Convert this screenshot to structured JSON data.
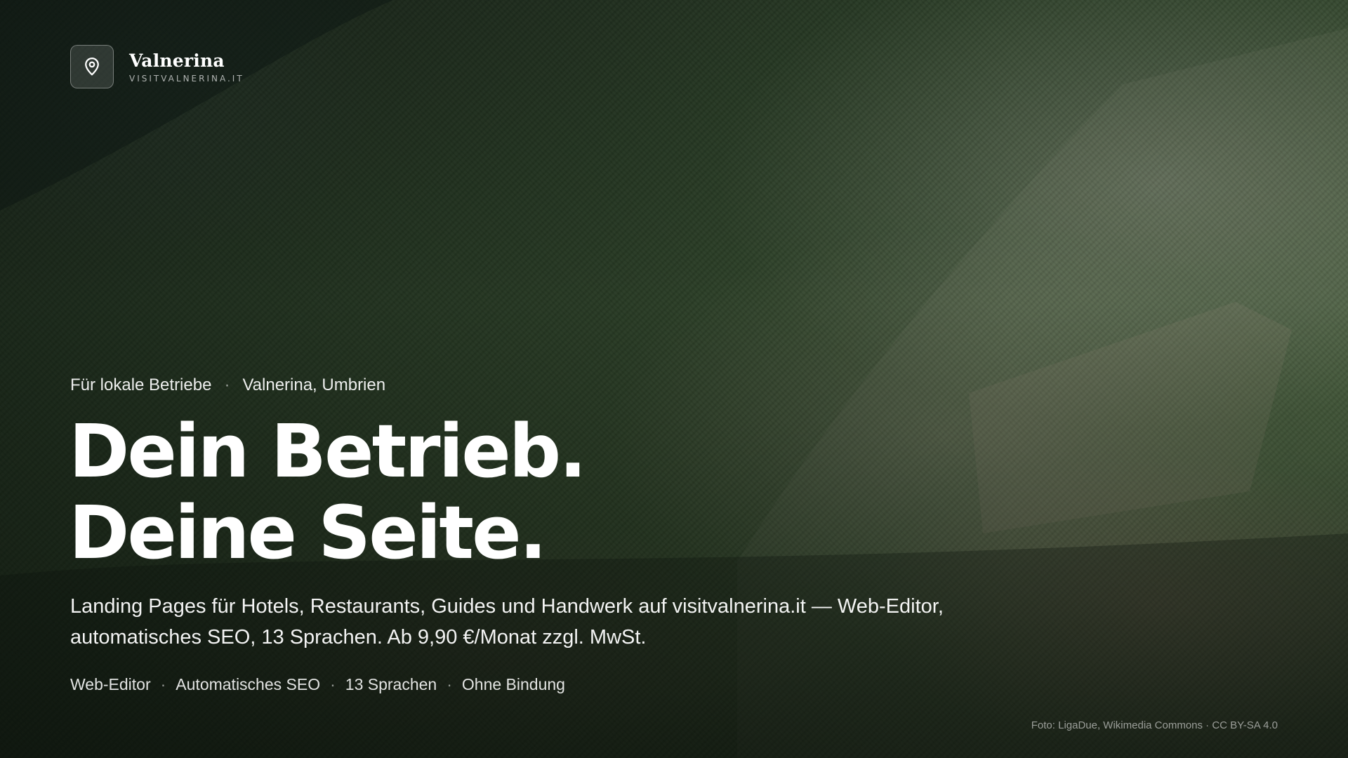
{
  "brand": {
    "name": "Valnerina",
    "url": "VISITVALNERINA.IT",
    "icon": "map-pin-icon"
  },
  "hero": {
    "eyebrow": {
      "audience": "Für lokale Betriebe",
      "separator": "·",
      "region": "Valnerina, Umbrien"
    },
    "headline": {
      "line1": "Dein Betrieb.",
      "line2": "Deine Seite."
    },
    "lede": "Landing Pages für Hotels, Restaurants, Guides und Handwerk auf visitvalnerina.it — Web-Editor, automatisches SEO, 13 Sprachen. Ab 9,90 €/Monat zzgl. MwSt.",
    "features": [
      "Web-Editor",
      "Automatisches SEO",
      "13 Sprachen",
      "Ohne Bindung"
    ],
    "feature_separator": "·"
  },
  "photo_credit": "Foto: LigaDue, Wikimedia Commons · CC BY-SA 4.0",
  "colors": {
    "text": "#ffffff",
    "overlay": "#080e0a",
    "forest": "#3a5232"
  }
}
